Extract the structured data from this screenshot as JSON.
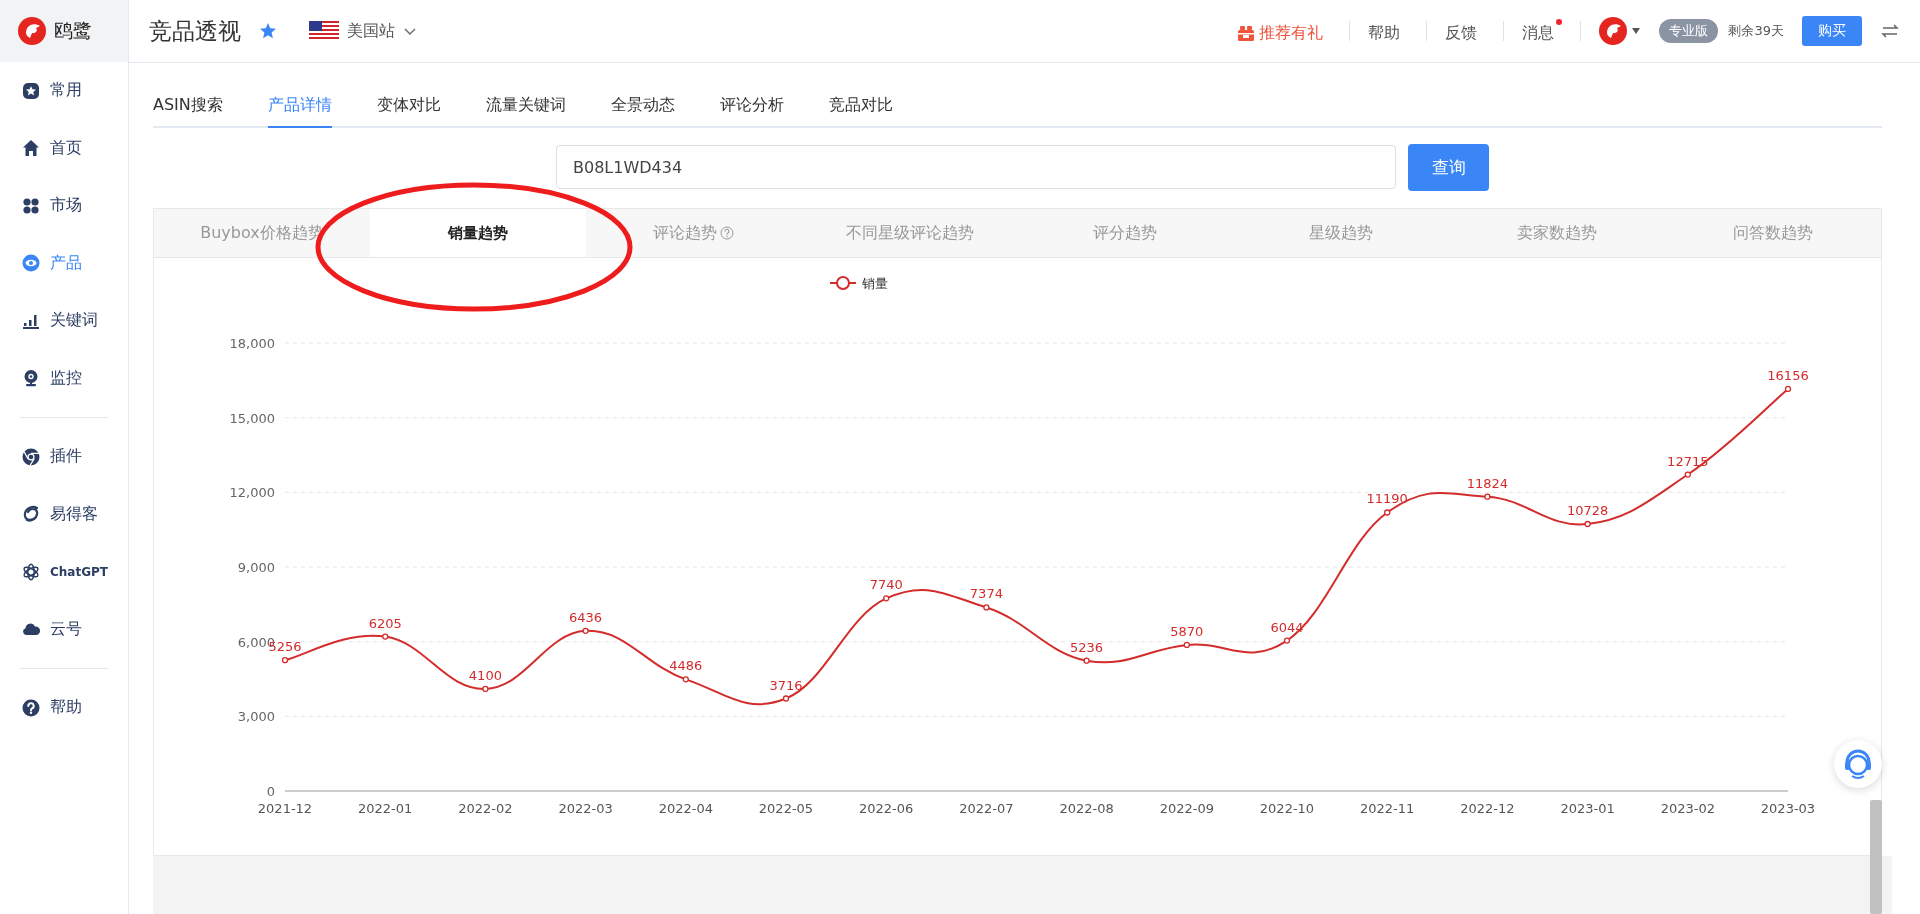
{
  "brand": {
    "name": "鸥鹭"
  },
  "sidebar": {
    "groups": [
      [
        {
          "label": "常用",
          "selected": false
        },
        {
          "label": "首页",
          "selected": false
        },
        {
          "label": "市场",
          "selected": false
        },
        {
          "label": "产品",
          "selected": true
        },
        {
          "label": "关键词",
          "selected": false
        },
        {
          "label": "监控",
          "selected": false
        }
      ],
      [
        {
          "label": "插件",
          "selected": false
        },
        {
          "label": "易得客",
          "selected": false
        },
        {
          "label": "ChatGPT",
          "selected": false
        },
        {
          "label": "云号",
          "selected": false
        }
      ],
      [
        {
          "label": "帮助",
          "selected": false
        }
      ]
    ]
  },
  "header": {
    "title": "竞品透视",
    "favorite": true,
    "site": "美国站",
    "links": [
      {
        "label": "推荐有礼",
        "kind": "promo",
        "unread": false
      },
      {
        "label": "帮助",
        "kind": "plain",
        "unread": false
      },
      {
        "label": "反馈",
        "kind": "plain",
        "unread": false
      },
      {
        "label": "消息",
        "kind": "plain",
        "unread": true
      }
    ],
    "plan": "专业版",
    "remaining": "剩余39天",
    "buy": "购买"
  },
  "tabs": [
    {
      "label": "ASIN搜索",
      "selected": false
    },
    {
      "label": "产品详情",
      "selected": true
    },
    {
      "label": "变体对比",
      "selected": false
    },
    {
      "label": "流量关键词",
      "selected": false
    },
    {
      "label": "全景动态",
      "selected": false
    },
    {
      "label": "评论分析",
      "selected": false
    },
    {
      "label": "竞品对比",
      "selected": false
    }
  ],
  "search": {
    "value": "B08L1WD434",
    "button": "查询"
  },
  "chart_tabs": [
    {
      "label": "Buybox价格趋势",
      "selected": false,
      "has_help": false
    },
    {
      "label": "销量趋势",
      "selected": true,
      "has_help": false
    },
    {
      "label": "评论趋势",
      "selected": false,
      "has_help": true
    },
    {
      "label": "不同星级评论趋势",
      "selected": false,
      "has_help": false
    },
    {
      "label": "评分趋势",
      "selected": false,
      "has_help": false
    },
    {
      "label": "星级趋势",
      "selected": false,
      "has_help": false
    },
    {
      "label": "卖家数趋势",
      "selected": false,
      "has_help": false
    },
    {
      "label": "问答数趋势",
      "selected": false,
      "has_help": false
    }
  ],
  "chart": {
    "chart_data": {
      "type": "line",
      "categories": [
        "2021-12",
        "2022-01",
        "2022-02",
        "2022-03",
        "2022-04",
        "2022-05",
        "2022-06",
        "2022-07",
        "2022-08",
        "2022-09",
        "2022-10",
        "2022-11",
        "2022-12",
        "2023-01",
        "2023-02",
        "2023-03"
      ],
      "grid": true,
      "series": [
        {
          "name": "销量",
          "color": "#d42b2b",
          "marker": true,
          "values": [
            5256,
            6205,
            4100,
            6436,
            4486,
            3716,
            7740,
            7374,
            5236,
            5870,
            6044,
            11190,
            11824,
            10728,
            12715,
            16156
          ]
        }
      ],
      "ylim": [
        0,
        18000
      ],
      "yticks": [
        {
          "value": 0,
          "label": "0"
        },
        {
          "value": 3000,
          "label": "3,000"
        },
        {
          "value": 6000,
          "label": "6,000"
        },
        {
          "value": 9000,
          "label": "9,000"
        },
        {
          "value": 12000,
          "label": "12,000"
        },
        {
          "value": 15000,
          "label": "15,000"
        },
        {
          "value": 18000,
          "label": "18,000"
        }
      ],
      "data_labels": true
    }
  }
}
